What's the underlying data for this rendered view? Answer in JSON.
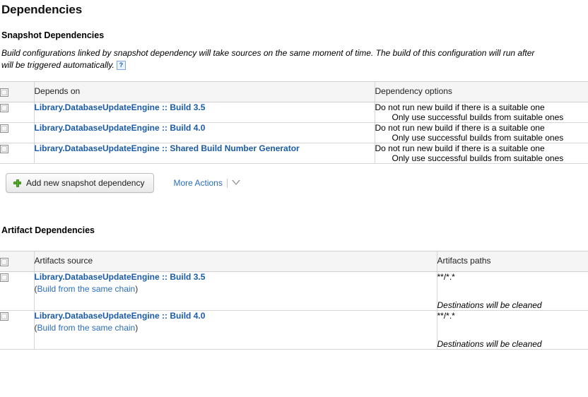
{
  "page": {
    "title": "Dependencies"
  },
  "snapshot": {
    "heading": "Snapshot Dependencies",
    "description_line1": "Build configurations linked by snapshot dependency will take sources on the same moment of time. The build of this configuration will run after",
    "description_line2": "will be triggered automatically.",
    "help_icon": "help-icon",
    "help_glyph": "?",
    "columns": {
      "depends_on": "Depends on",
      "dependency_options": "Dependency options"
    },
    "rows": [
      {
        "project": "Library.DatabaseUpdateEngine",
        "separator": "::",
        "build": "Build 3.5",
        "option1": "Do not run new build if there is a suitable one",
        "option2": "Only use successful builds from suitable ones"
      },
      {
        "project": "Library.DatabaseUpdateEngine",
        "separator": "::",
        "build": "Build 4.0",
        "option1": "Do not run new build if there is a suitable one",
        "option2": "Only use successful builds from suitable ones"
      },
      {
        "project": "Library.DatabaseUpdateEngine",
        "separator": "::",
        "build": "Shared Build Number Generator",
        "option1": "Do not run new build if there is a suitable one",
        "option2": "Only use successful builds from suitable ones"
      }
    ],
    "add_button_label": "Add new snapshot dependency",
    "add_button_icon": "plus-icon",
    "more_actions_label": "More Actions",
    "more_actions_icon": "chevron-down-icon"
  },
  "artifact": {
    "heading": "Artifact Dependencies",
    "columns": {
      "artifacts_source": "Artifacts source",
      "artifacts_paths": "Artifacts paths"
    },
    "rows": [
      {
        "project": "Library.DatabaseUpdateEngine",
        "separator": "::",
        "build": "Build 3.5",
        "chain_open": "(",
        "chain_link": "Build from the same chain",
        "chain_close": ")",
        "path": "**/*.*",
        "note": "Destinations will be cleaned"
      },
      {
        "project": "Library.DatabaseUpdateEngine",
        "separator": "::",
        "build": "Build 4.0",
        "chain_open": "(",
        "chain_link": "Build from the same chain",
        "chain_close": ")",
        "path": "**/*.*",
        "note": "Destinations will be cleaned"
      }
    ]
  },
  "colors": {
    "link_blue": "#1a5ba8",
    "soft_link_blue": "#2a6dbd",
    "header_bg": "#f5f5f5",
    "border": "#d6d6d6",
    "plus_green": "#56ac30"
  }
}
